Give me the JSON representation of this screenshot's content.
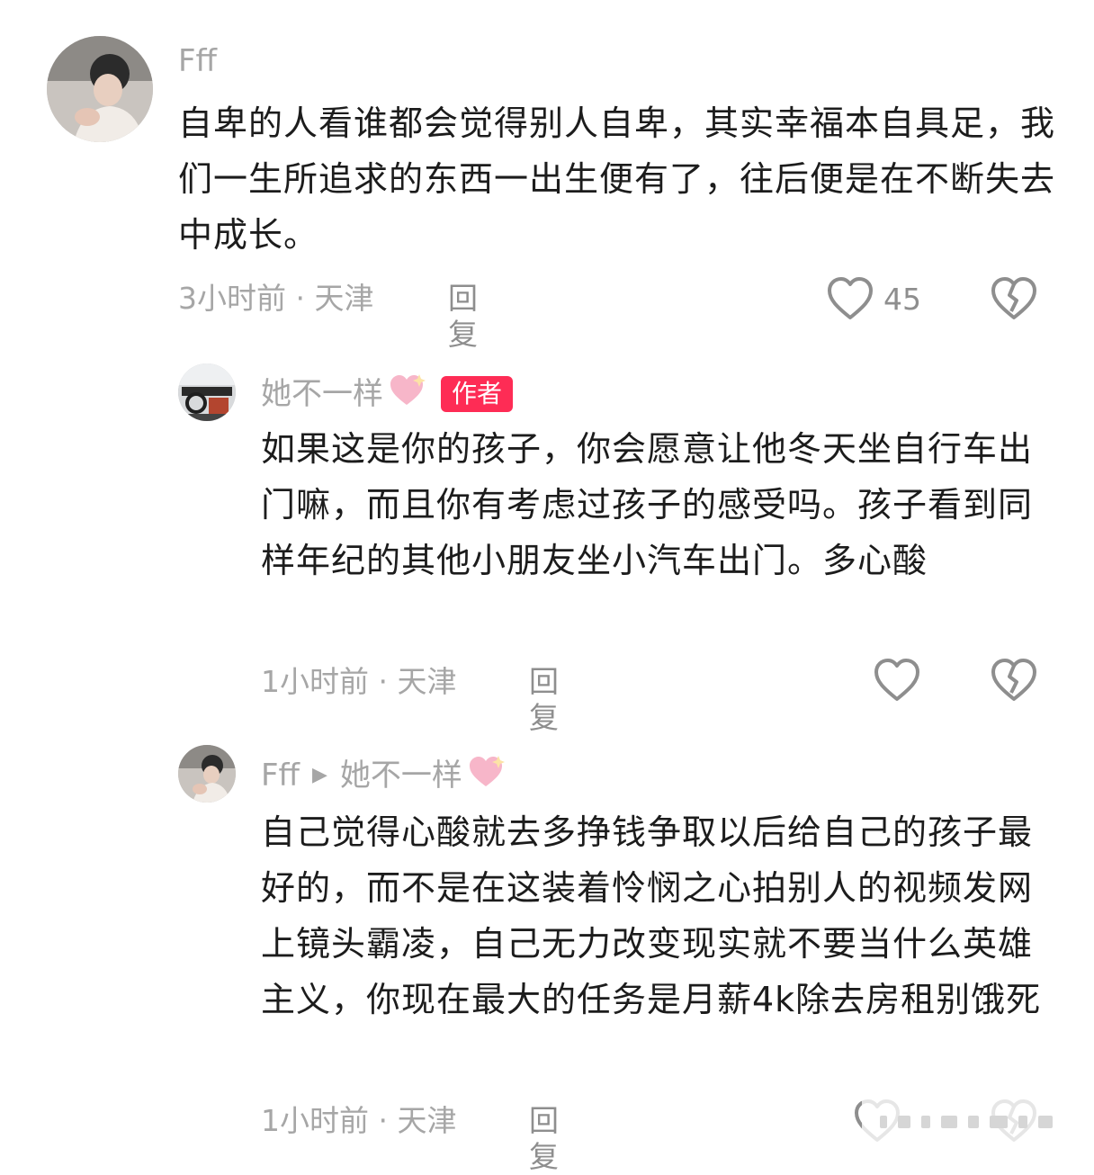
{
  "comments": [
    {
      "username": "Fff",
      "text": "自卑的人看谁都会觉得别人自卑，其实幸福本自具足，我们一生所追求的东西一出生便有了，往后便是在不断失去中成长。",
      "time": "3小时前 · 天津",
      "reply_label": "回复",
      "likes": "45",
      "avatar_icon": "user-photo"
    },
    {
      "username": "她不一样",
      "badge": "作者",
      "text": "如果这是你的孩子，你会愿意让他冬天坐自行车出门嘛，而且你有考虑过孩子的感受吗。孩子看到同样年纪的其他小朋友坐小汽车出门。多心酸",
      "time": "1小时前 · 天津",
      "reply_label": "回复",
      "likes": "",
      "avatar_icon": "car-interior-photo"
    },
    {
      "username": "Fff",
      "reply_to": "她不一样",
      "text": "自己觉得心酸就去多挣钱争取以后给自己的孩子最好的，而不是在这装着怜悯之心拍别人的视频发网上镜头霸凌，自己无力改变现实就不要当什么英雄主义，你现在最大的任务是月薪4k除去房租别饿死",
      "time": "1小时前 · 天津",
      "reply_label": "回复",
      "likes": "",
      "avatar_icon": "user-photo"
    }
  ],
  "colors": {
    "badge": "#fe2c55",
    "meta_text": "#a6a6a6",
    "body_text": "#1c1c1c",
    "heart_deco": "#f7b6c9"
  }
}
